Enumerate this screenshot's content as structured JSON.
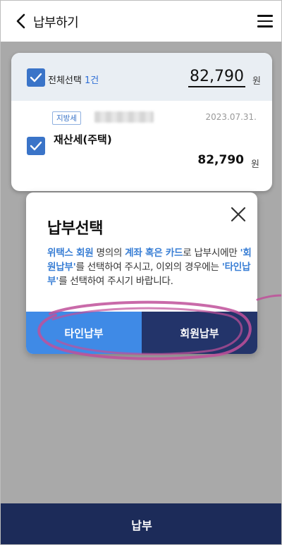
{
  "header": {
    "title": "납부하기",
    "back_icon": "chevron-left-icon",
    "menu_icon": "hamburger-menu-icon"
  },
  "card": {
    "select_all_label": "전체선택",
    "count": "1건",
    "total_amount": "82,790",
    "currency": "원",
    "item": {
      "tax_type": "지방세",
      "date": "2023.07.31.",
      "name": "재산세(주택)",
      "amount": "82,790",
      "currency": "원"
    }
  },
  "modal": {
    "title": "납부선택",
    "msg": {
      "p1": "위택스 회원",
      "p2": " 명의의 ",
      "p3": "계좌 혹은 카드",
      "p4": "로 납부시에만 ",
      "p5": "'회원납부'",
      "p6": "를 선택하여 주시고, 이외의 경우에는 ",
      "p7": "'타인납부'",
      "p8": "를 선택하여 주시기 바랍니다."
    },
    "other_payment_button": "타인납부",
    "member_payment_button": "회원납부"
  },
  "footer": {
    "pay_button": "납부"
  },
  "colors": {
    "accent_blue": "#3a74c8",
    "other_btn": "#3f8ae6",
    "member_btn": "#23346a",
    "footer_bg": "#1c2b59",
    "highlight_text": "#3a7fd5",
    "annotation": "#c0509a"
  }
}
